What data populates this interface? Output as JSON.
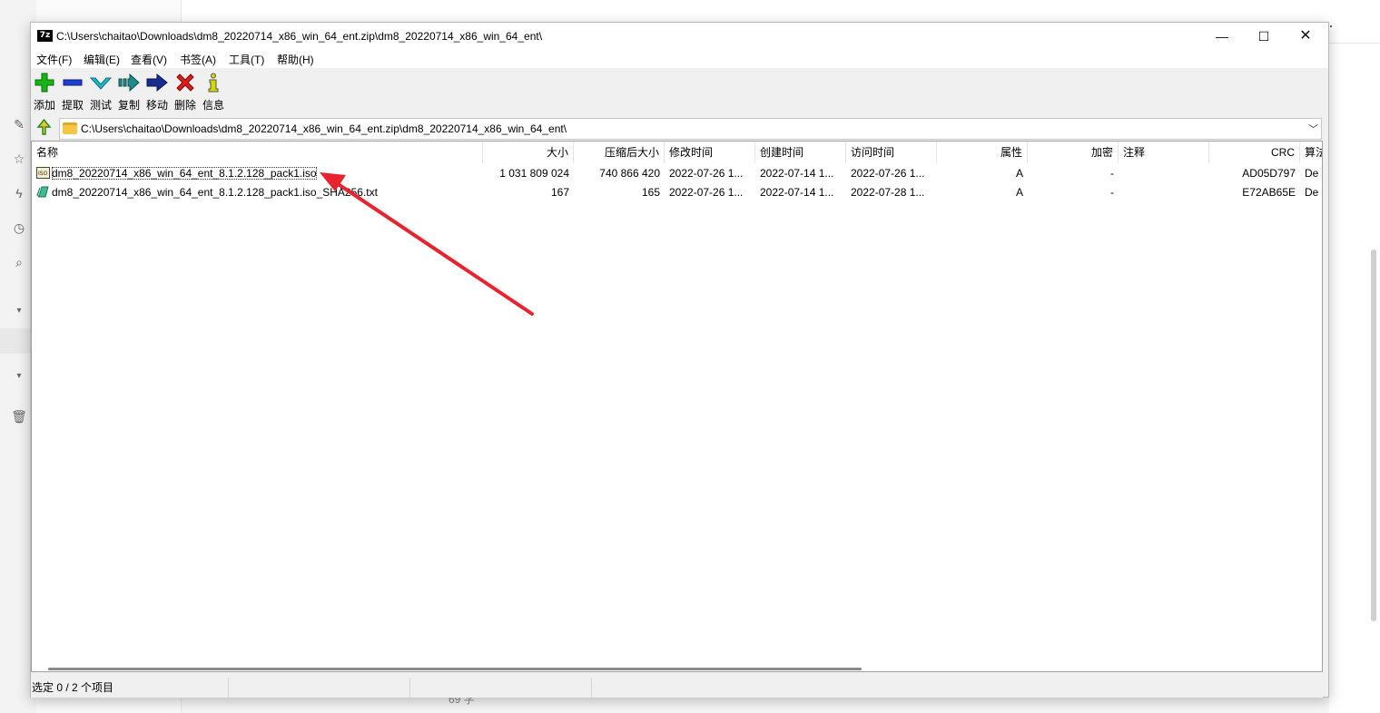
{
  "background_app": {
    "word_count": "69 字",
    "more_menu": "···"
  },
  "window": {
    "title": "C:\\Users\\chaitao\\Downloads\\dm8_20220714_x86_win_64_ent.zip\\dm8_20220714_x86_win_64_ent\\",
    "app_icon_text": "7z",
    "controls": {
      "minimize": "—",
      "maximize": "☐",
      "close": "✕"
    }
  },
  "menu": [
    {
      "label": "文件(F)"
    },
    {
      "label": "编辑(E)"
    },
    {
      "label": "查看(V)"
    },
    {
      "label": "书签(A)"
    },
    {
      "label": "工具(T)"
    },
    {
      "label": "帮助(H)"
    }
  ],
  "toolbar": [
    {
      "label": "添加",
      "icon": "plus-icon",
      "color": "#17b417"
    },
    {
      "label": "提取",
      "icon": "minus-icon",
      "color": "#1a3fd1"
    },
    {
      "label": "测试",
      "icon": "check-icon",
      "color": "#1fb8c9"
    },
    {
      "label": "复制",
      "icon": "copy-arrow-icon",
      "color": "#1f8a8a"
    },
    {
      "label": "移动",
      "icon": "move-arrow-icon",
      "color": "#1a2c8c"
    },
    {
      "label": "删除",
      "icon": "delete-x-icon",
      "color": "#e01b1b"
    },
    {
      "label": "信息",
      "icon": "info-icon",
      "color": "#d8d800"
    }
  ],
  "address": {
    "path": "C:\\Users\\chaitao\\Downloads\\dm8_20220714_x86_win_64_ent.zip\\dm8_20220714_x86_win_64_ent\\"
  },
  "columns": [
    "名称",
    "大小",
    "压缩后大小",
    "修改时间",
    "创建时间",
    "访问时间",
    "属性",
    "加密",
    "注释",
    "CRC",
    "算法"
  ],
  "files": [
    {
      "name": "dm8_20220714_x86_win_64_ent_8.1.2.128_pack1.iso",
      "icon": "iso-file-icon",
      "size": "1 031 809 024",
      "packed": "740 866 420",
      "modified": "2022-07-26 1...",
      "created": "2022-07-14 1...",
      "accessed": "2022-07-26 1...",
      "attr": "A",
      "encrypted": "-",
      "comment": "",
      "crc": "AD05D797",
      "method": "De"
    },
    {
      "name": "dm8_20220714_x86_win_64_ent_8.1.2.128_pack1.iso_SHA256.txt",
      "icon": "txt-file-icon",
      "size": "167",
      "packed": "165",
      "modified": "2022-07-26 1...",
      "created": "2022-07-14 1...",
      "accessed": "2022-07-28 1...",
      "attr": "A",
      "encrypted": "-",
      "comment": "",
      "crc": "E72AB65E",
      "method": "De"
    }
  ],
  "status": {
    "selection": "选定 0 / 2 个项目",
    "cell2": "",
    "cell3": ""
  },
  "annotation_color": "#e8232d"
}
